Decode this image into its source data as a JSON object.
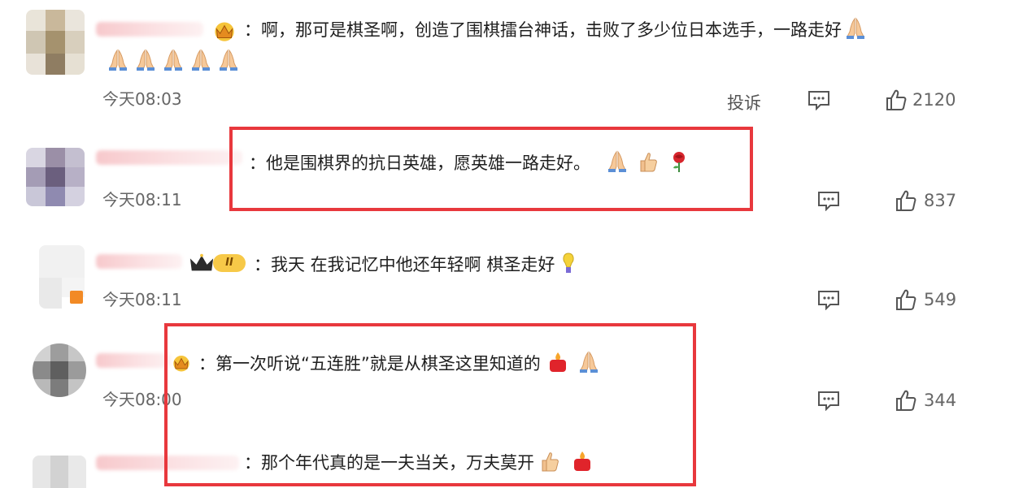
{
  "comments": [
    {
      "text": "：啊，那可是棋圣啊，创造了围棋擂台神话，击败了多少位日本选手，一路走好",
      "time": "今天08:03",
      "report_label": "投诉",
      "likes": "2120"
    },
    {
      "text": "：他是围棋界的抗日英雄，愿英雄一路走好。",
      "time": "今天08:11",
      "likes": "837"
    },
    {
      "badge_text": "II",
      "text": "：我天 在我记忆中他还年轻啊 棋圣走好",
      "time": "今天08:11",
      "likes": "549"
    },
    {
      "text": "：第一次听说“五连胜”就是从棋圣这里知道的",
      "time": "今天08:00",
      "likes": "344"
    },
    {
      "text": "：那个年代真的是一夫当关，万夫莫开"
    }
  ],
  "colors": {
    "highlight_box": "#e8383d",
    "text": "#1f1f1f",
    "meta": "#666666"
  },
  "icons": [
    "pray-emoji",
    "thumbs-up-emoji",
    "rose-emoji",
    "fire-emoji",
    "crown-badge",
    "comment-icon",
    "like-icon"
  ]
}
